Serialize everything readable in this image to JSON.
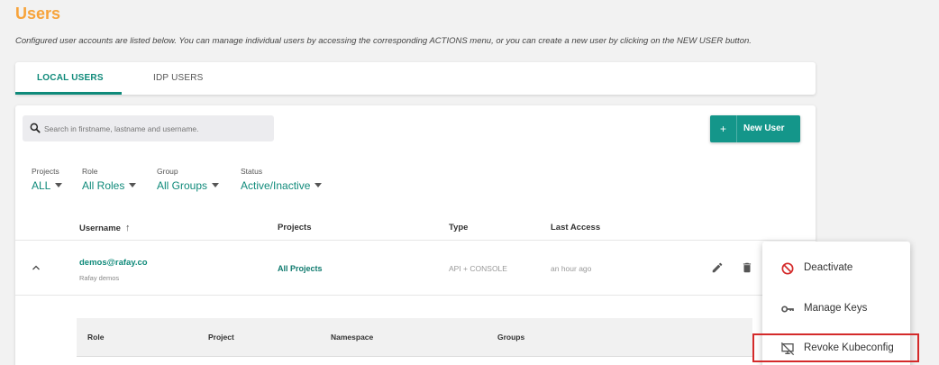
{
  "page": {
    "title": "Users",
    "description": "Configured user accounts are listed below. You can manage individual users by accessing the corresponding ACTIONS menu, or you can create a new user by clicking on the NEW USER button."
  },
  "tabs": [
    {
      "label": "LOCAL USERS",
      "active": true
    },
    {
      "label": "IDP USERS",
      "active": false
    }
  ],
  "search": {
    "placeholder": "Search in firstname, lastname and username."
  },
  "new_user_button": {
    "icon": "+",
    "label": "New User"
  },
  "filters": [
    {
      "label": "Projects",
      "value": "ALL"
    },
    {
      "label": "Role",
      "value": "All Roles"
    },
    {
      "label": "Group",
      "value": "All Groups"
    },
    {
      "label": "Status",
      "value": "Active/Inactive"
    }
  ],
  "table": {
    "columns": [
      "Username",
      "Projects",
      "Type",
      "Last Access"
    ],
    "rows": [
      {
        "username": "demos@rafay.co",
        "subtitle": "Rafay demos",
        "projects": "All Projects",
        "type": "API + CONSOLE",
        "last_access": "an hour ago"
      }
    ]
  },
  "sub_table": {
    "columns": [
      "Role",
      "Project",
      "Namespace",
      "Groups"
    ]
  },
  "actions_menu": {
    "items": [
      {
        "label": "Deactivate",
        "icon": "block-icon"
      },
      {
        "label": "Manage Keys",
        "icon": "key-icon"
      },
      {
        "label": "Revoke Kubeconfig",
        "icon": "desktop-off-icon"
      }
    ]
  },
  "colors": {
    "title": "#f7a33a",
    "accent": "#0f8a7a",
    "button": "#14968a",
    "highlight": "#d42a2a",
    "deactivate_icon": "#d42a2a"
  }
}
